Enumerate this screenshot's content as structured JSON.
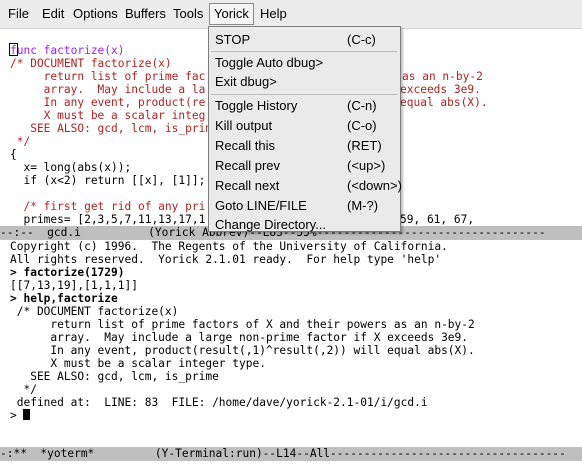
{
  "menubar": {
    "items": [
      "File",
      "Edit",
      "Options",
      "Buffers",
      "Tools",
      "Yorick",
      "Help"
    ]
  },
  "code_buffer": {
    "lines": [
      "func factorize(x)",
      "/* DOCUMENT factorize(x)",
      "     return list of prime fac",
      "     array.  May include a la",
      "     In any event, product(re",
      "     X must be a scalar integ",
      "   SEE ALSO: gcd, lcm, is_prim",
      " */",
      "{",
      "  x= long(abs(x));",
      "  if (x<2) return [[x], [1]];",
      "",
      "  /* first get rid of any pri",
      "  primes= [2,3,5,7,11,13,17,1"
    ],
    "tails": [
      "",
      "",
      "as an n-by-2",
      "exceeds 3e9.",
      "equal abs(X).",
      "",
      "",
      "",
      "",
      "",
      "",
      "",
      "",
      "59, 61, 67,"
    ],
    "modeline": "--:--  gcd.i          (Yorick Abbrev)--L83--55%----------------------------------"
  },
  "terminal_buffer": {
    "lines": [
      "Copyright (c) 1996.  The Regents of the University of California.",
      "All rights reserved.  Yorick 2.1.01 ready.  For help type 'help'",
      "> factorize(1729)",
      "[[7,13,19],[1,1,1]]",
      "> help,factorize",
      " /* DOCUMENT factorize(x)",
      "      return list of prime factors of X and their powers as an n-by-2",
      "      array.  May include a large non-prime factor if X exceeds 3e9.",
      "      In any event, product(result(,1)^result(,2)) will equal abs(X).",
      "      X must be a scalar integer type.",
      "   SEE ALSO: gcd, lcm, is_prime",
      "  */",
      " defined at:  LINE: 83  FILE: /home/dave/yorick-2.1-01/i/gcd.i",
      "> "
    ],
    "modeline": "-:**  *yoterm*         (Y-Terminal:run)--L14--All-----------------------------------"
  },
  "yorick_menu": {
    "items": [
      {
        "label": "STOP",
        "shortcut": "(C-c)"
      },
      {
        "label": "Toggle Auto dbug>",
        "shortcut": ""
      },
      {
        "label": "Exit dbug>",
        "shortcut": ""
      },
      {
        "label": "Toggle History",
        "shortcut": "(C-n)"
      },
      {
        "label": "Kill output",
        "shortcut": "(C-o)"
      },
      {
        "label": "Recall this",
        "shortcut": "(RET)"
      },
      {
        "label": "Recall prev",
        "shortcut": "(<up>)"
      },
      {
        "label": "Recall next",
        "shortcut": "(<down>)"
      },
      {
        "label": "Goto LINE/FILE",
        "shortcut": "(M-?)"
      },
      {
        "label": "Change Directory...",
        "shortcut": ""
      }
    ]
  },
  "colors": {
    "keyword": "#a020f0",
    "function_name": "#0000ff",
    "comment": "#b22222",
    "string": "#228b22",
    "modeline_bg": "#bfbfbf"
  }
}
